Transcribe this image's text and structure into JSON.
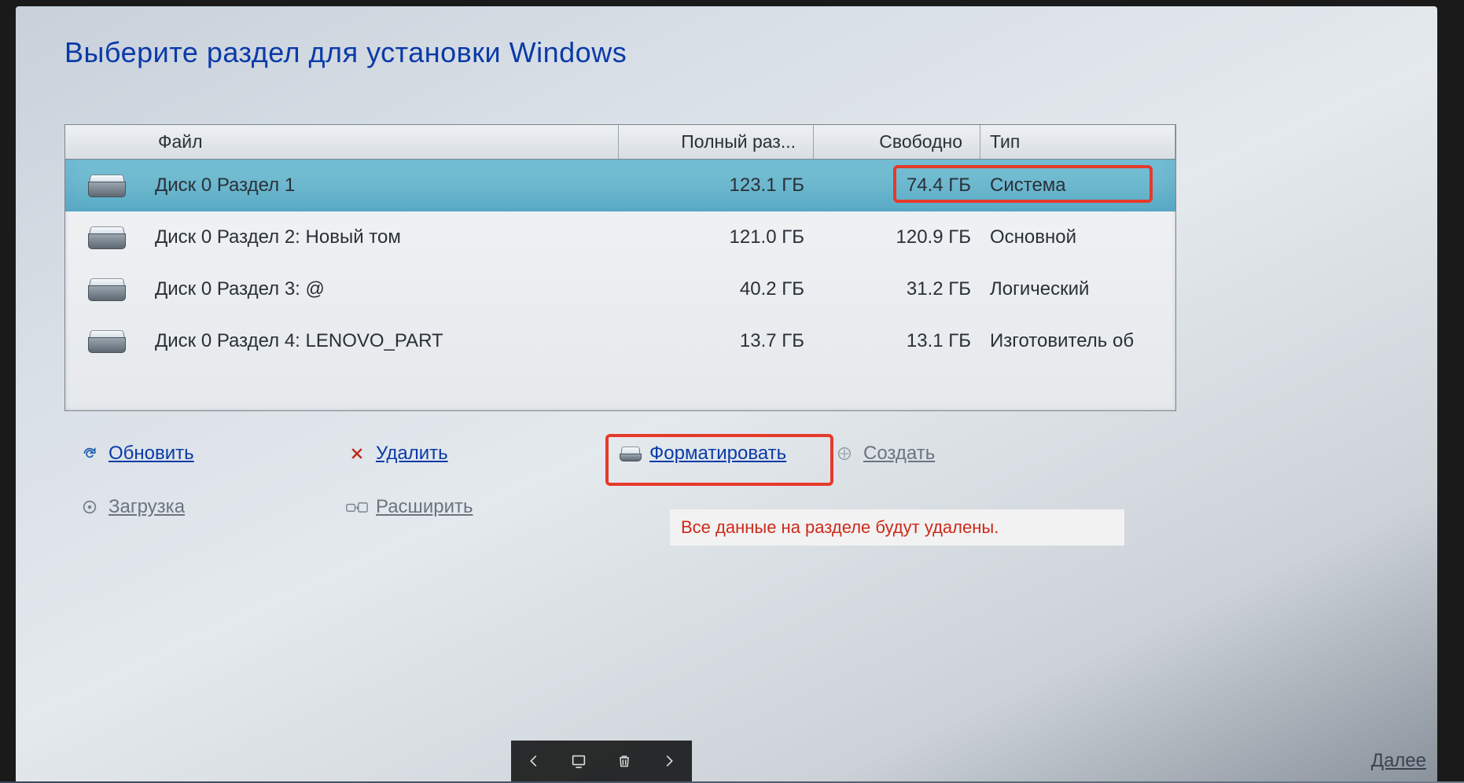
{
  "title": "Выберите раздел для установки Windows",
  "columns": {
    "file": "Файл",
    "total": "Полный раз...",
    "free": "Свободно",
    "type": "Тип"
  },
  "partitions": [
    {
      "name": "Диск 0 Раздел 1",
      "total": "123.1 ГБ",
      "free": "74.4 ГБ",
      "type": "Система",
      "selected": true
    },
    {
      "name": "Диск 0 Раздел 2: Новый том",
      "total": "121.0 ГБ",
      "free": "120.9 ГБ",
      "type": "Основной",
      "selected": false
    },
    {
      "name": "Диск 0 Раздел 3: @",
      "total": "40.2 ГБ",
      "free": "31.2 ГБ",
      "type": "Логический",
      "selected": false
    },
    {
      "name": "Диск 0 Раздел 4: LENOVO_PART",
      "total": "13.7 ГБ",
      "free": "13.1 ГБ",
      "type": "Изготовитель об",
      "selected": false
    }
  ],
  "toolbar": {
    "refresh": "Обновить",
    "delete": "Удалить",
    "format": "Форматировать",
    "create": "Создать",
    "load": "Загрузка",
    "extend": "Расширить"
  },
  "warning": "Все данные на разделе будут удалены.",
  "next_label": "Далее"
}
